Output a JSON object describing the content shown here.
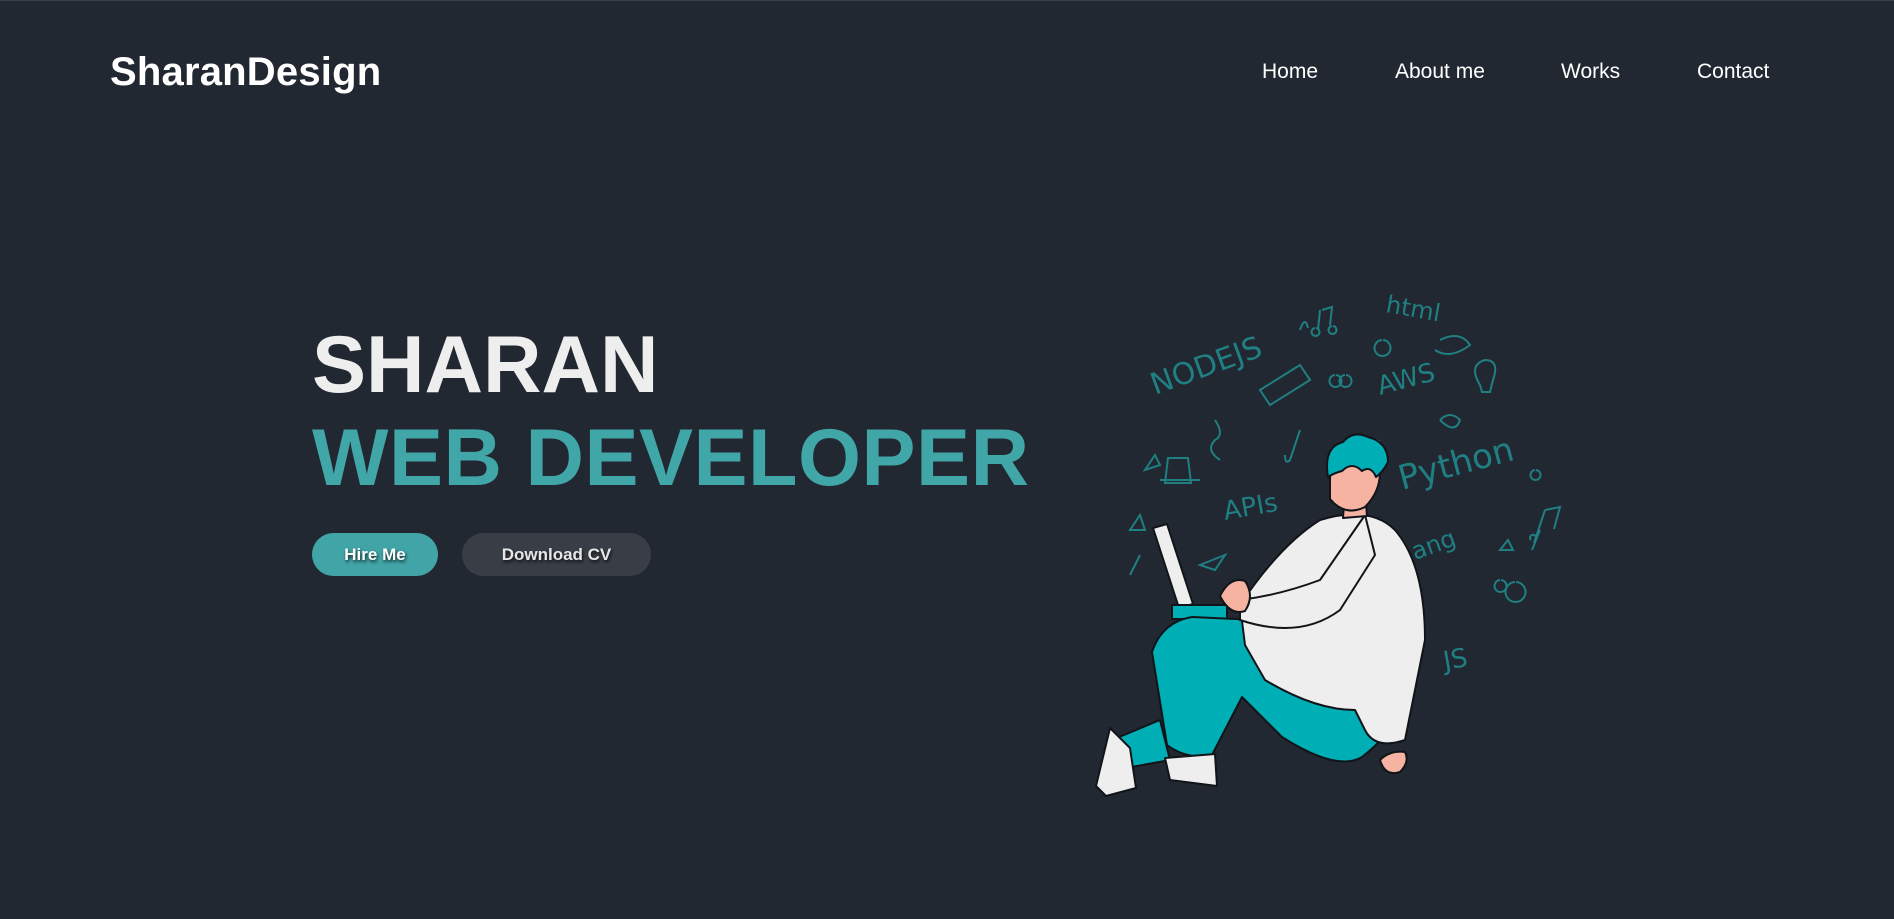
{
  "brand": {
    "name": "SharanDesign"
  },
  "nav": {
    "items": [
      {
        "label": "Home"
      },
      {
        "label": "About me"
      },
      {
        "label": "Works"
      },
      {
        "label": "Contact"
      }
    ]
  },
  "hero": {
    "name": "SHARAN",
    "role": "WEB DEVELOPER",
    "primary_button": "Hire Me",
    "secondary_button": "Download CV"
  },
  "illustration": {
    "doodle_words": [
      "html",
      "NODEJS",
      "AWS",
      "Python",
      "APIs",
      "ang",
      "JS"
    ]
  },
  "colors": {
    "background": "#222831",
    "accent": "#40a6a8",
    "button_dark": "#393e46",
    "text": "#eeeeee"
  }
}
